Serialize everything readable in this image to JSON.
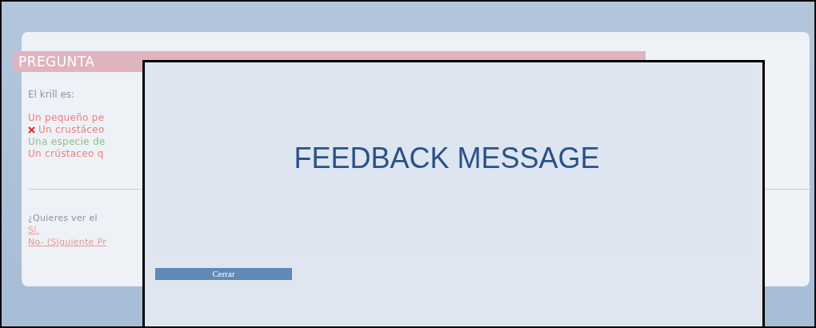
{
  "question": {
    "heading": "PREGUNTA",
    "prompt": "El krill es:",
    "options": [
      {
        "text": "Un pequeño pe",
        "kind": "wrong",
        "marked": false
      },
      {
        "text": "Un crustáceo",
        "kind": "wrong",
        "marked": true
      },
      {
        "text": "Una especie de",
        "kind": "correct",
        "marked": false
      },
      {
        "text": "Un crústaceo q",
        "kind": "wrong",
        "marked": false
      }
    ],
    "follow_up": "¿Quieres ver el",
    "links": [
      "Sí.",
      "No- (Siguiente Pr"
    ]
  },
  "dialog": {
    "message": "FEEDBACK MESSAGE",
    "button": "Cerrar"
  }
}
